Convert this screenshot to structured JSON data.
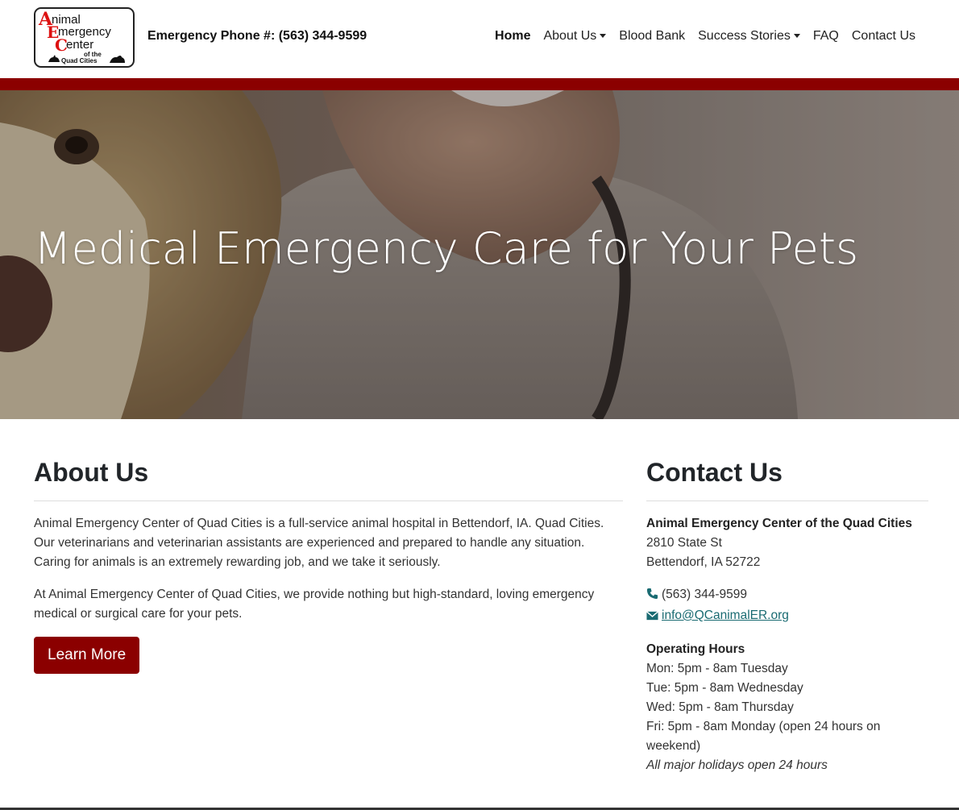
{
  "header": {
    "logo": {
      "line1": "nimal",
      "line2": "mergency",
      "line3": "enter",
      "line4": "of the",
      "line5": "Quad Cities",
      "initial_a": "A",
      "initial_e": "E",
      "initial_c": "C"
    },
    "phone": "Emergency Phone #: (563) 344-9599",
    "nav": [
      {
        "label": "Home",
        "active": true
      },
      {
        "label": "About Us",
        "dropdown": true
      },
      {
        "label": "Blood Bank"
      },
      {
        "label": "Success Stories",
        "dropdown": true
      },
      {
        "label": "FAQ"
      },
      {
        "label": "Contact Us"
      }
    ]
  },
  "hero": {
    "title": "Medical Emergency Care for Your Pets"
  },
  "about": {
    "heading": "About Us",
    "p1": "Animal Emergency Center of Quad Cities is a full-service animal hospital in Bettendorf, IA. Quad Cities. Our veterinarians and veterinarian assistants are experienced and prepared to handle any situation. Caring for animals is an extremely rewarding job, and we take it seriously.",
    "p2": "At Animal Emergency Center of Quad Cities, we provide nothing but high-standard, loving emergency medical or surgical care for your pets.",
    "button": "Learn More"
  },
  "contact": {
    "heading": "Contact Us",
    "name": "Animal Emergency Center of the Quad Cities",
    "street": "2810 State St",
    "city": "Bettendorf, IA 52722",
    "phone": "(563) 344-9599",
    "email": "info@QCanimalER.org",
    "hours_heading": "Operating Hours",
    "hours": [
      "Mon: 5pm - 8am Tuesday",
      "Tue: 5pm - 8am Wednesday",
      "Wed: 5pm - 8am Thursday",
      "Fri: 5pm - 8am Monday (open 24 hours on weekend)"
    ],
    "holidays": "All major holidays open 24 hours"
  },
  "colors": {
    "brand_red": "#8b0000",
    "link": "#1a6b72"
  },
  "icons": {
    "phone": "phone-icon",
    "email": "envelope-icon"
  }
}
